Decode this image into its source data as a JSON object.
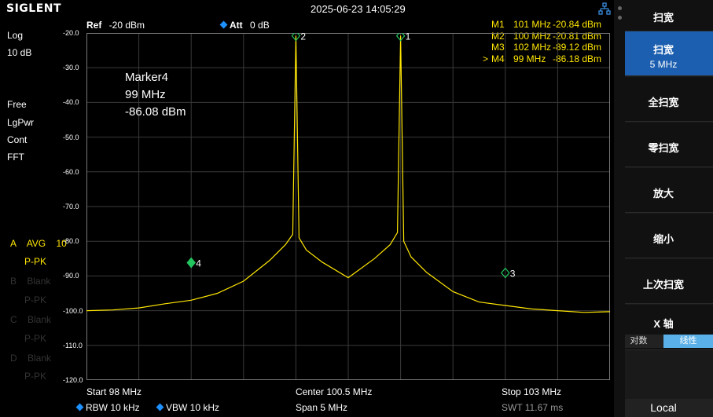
{
  "topbar": {
    "brand": "SIGLENT",
    "datetime": "2025-06-23 14:05:29",
    "network_icon": "network-icon"
  },
  "left_panel": {
    "scale_type": "Log",
    "scale_div": "10 dB",
    "sweep_mode": "Free",
    "detector_type": "LgPwr",
    "trigger": "Cont",
    "sweep_type": "FFT",
    "traces": [
      {
        "id": "A",
        "mode": "AVG",
        "count": "10",
        "detector": "P-PK"
      },
      {
        "id": "B",
        "mode": "Blank",
        "detector": "P-PK"
      },
      {
        "id": "C",
        "mode": "Blank",
        "detector": "P-PK"
      },
      {
        "id": "D",
        "mode": "Blank",
        "detector": "P-PK"
      }
    ]
  },
  "header": {
    "ref_label": "Ref",
    "ref_value": "-20 dBm",
    "att_label": "Att",
    "att_value": "0 dB"
  },
  "markers": [
    {
      "pointer": "",
      "name": "M1",
      "freq": "101 MHz",
      "level": "-20.84 dBm"
    },
    {
      "pointer": "",
      "name": "M2",
      "freq": "100 MHz",
      "level": "-20.81 dBm"
    },
    {
      "pointer": "",
      "name": "M3",
      "freq": "102 MHz",
      "level": "-89.12 dBm"
    },
    {
      "pointer": ">",
      "name": "M4",
      "freq": "99 MHz",
      "level": "-86.18 dBm"
    }
  ],
  "marker_readout": {
    "name": "Marker4",
    "freq": "99 MHz",
    "level": "-86.08 dBm"
  },
  "bottom": {
    "start": "Start  98 MHz",
    "center": "Center  100.5 MHz",
    "stop": "Stop  103 MHz",
    "rbw": "RBW  10 kHz",
    "vbw": "VBW  10 kHz",
    "span": "Span   5 MHz",
    "swt": "SWT  11.67 ms"
  },
  "sidebar": {
    "title": "扫宽",
    "span_key": "扫宽",
    "span_value": "5 MHz",
    "full_span": "全扫宽",
    "zero_span": "零扫宽",
    "zoom_in": "放大",
    "zoom_out": "缩小",
    "last_span": "上次扫宽",
    "x_axis": "X 轴",
    "x_axis_log": "对数",
    "x_axis_lin": "线性",
    "local": "Local"
  },
  "chart_data": {
    "type": "line",
    "title": "",
    "xlabel": "",
    "ylabel": "",
    "x_unit": "MHz",
    "y_unit": "dBm",
    "xlim": [
      98,
      103
    ],
    "ylim": [
      -120,
      -20
    ],
    "y_ticks": [
      "-20.0",
      "-30.0",
      "-40.0",
      "-50.0",
      "-60.0",
      "-70.0",
      "-80.0",
      "-90.0",
      "-100.0",
      "-110.0",
      "-120.0"
    ],
    "grid": true,
    "colors": {
      "trace": "#ffe600",
      "grid": "#3a3a3a",
      "marker": "#22c55e"
    },
    "series": [
      {
        "x": [
          98.0,
          98.25,
          98.5,
          98.75,
          99.0,
          99.25,
          99.5,
          99.75,
          99.9,
          99.97,
          100.0,
          100.03,
          100.1,
          100.25,
          100.5,
          100.75,
          100.9,
          100.97,
          101.0,
          101.03,
          101.1,
          101.25,
          101.5,
          101.75,
          102.0,
          102.25,
          102.5,
          102.75,
          103.0
        ],
        "y": [
          -100.0,
          -99.8,
          -99.2,
          -98.0,
          -97.0,
          -95.0,
          -91.5,
          -85.5,
          -81.0,
          -78.0,
          -20.8,
          -79.0,
          -82.5,
          -86.0,
          -90.5,
          -85.0,
          -81.0,
          -77.5,
          -20.8,
          -80.0,
          -84.5,
          -89.0,
          -94.5,
          -97.5,
          -98.5,
          -99.5,
          -100.0,
          -100.5,
          -100.3
        ]
      }
    ],
    "markers": [
      {
        "label": "1",
        "x": 101.0,
        "y": -20.84
      },
      {
        "label": "2",
        "x": 100.0,
        "y": -20.81
      },
      {
        "label": "3",
        "x": 102.0,
        "y": -89.12
      },
      {
        "label": "4",
        "x": 99.0,
        "y": -86.18
      }
    ]
  }
}
